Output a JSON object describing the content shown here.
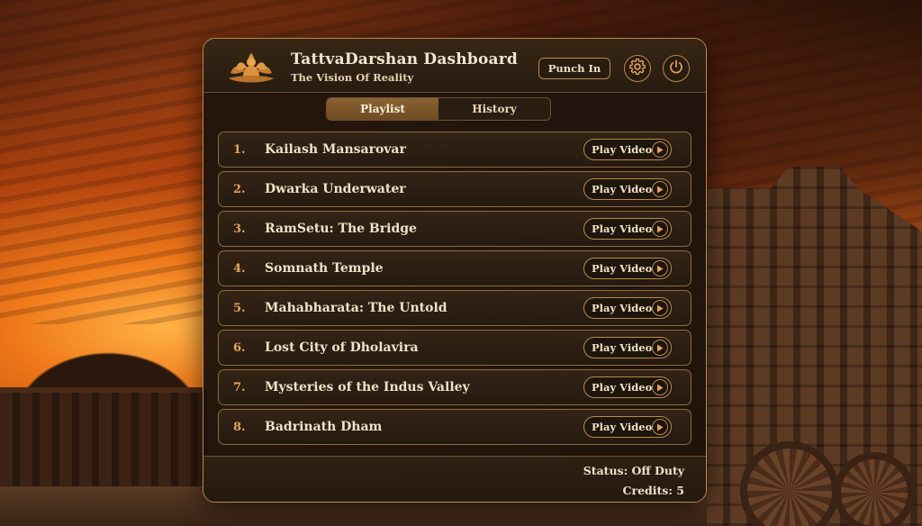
{
  "app": {
    "title": "TattvaDarshan Dashboard",
    "subtitle": "The Vision Of Reality"
  },
  "header": {
    "punch_label": "Punch In",
    "settings_icon": "gear-icon",
    "power_icon": "power-icon",
    "logo_icon": "lotus-meditation-icon"
  },
  "tabs": [
    {
      "label": "Playlist",
      "active": true
    },
    {
      "label": "History",
      "active": false
    }
  ],
  "playlist": [
    {
      "number": "1.",
      "title": "Kailash Mansarovar",
      "action": "Play Video"
    },
    {
      "number": "2.",
      "title": "Dwarka Underwater",
      "action": "Play Video"
    },
    {
      "number": "3.",
      "title": "RamSetu: The Bridge",
      "action": "Play Video"
    },
    {
      "number": "4.",
      "title": "Somnath Temple",
      "action": "Play Video"
    },
    {
      "number": "5.",
      "title": "Mahabharata: The Untold",
      "action": "Play Video"
    },
    {
      "number": "6.",
      "title": "Lost City of Dholavira",
      "action": "Play Video"
    },
    {
      "number": "7.",
      "title": "Mysteries of the Indus Valley",
      "action": "Play Video"
    },
    {
      "number": "8.",
      "title": "Badrinath Dham",
      "action": "Play Video"
    }
  ],
  "footer": {
    "status": "Status: Off Duty",
    "credits": "Credits: 5"
  },
  "colors": {
    "accent": "#b98a4a",
    "panel_bg": "#1e140c",
    "number": "#e6a55a",
    "text": "#f0e2c8"
  }
}
